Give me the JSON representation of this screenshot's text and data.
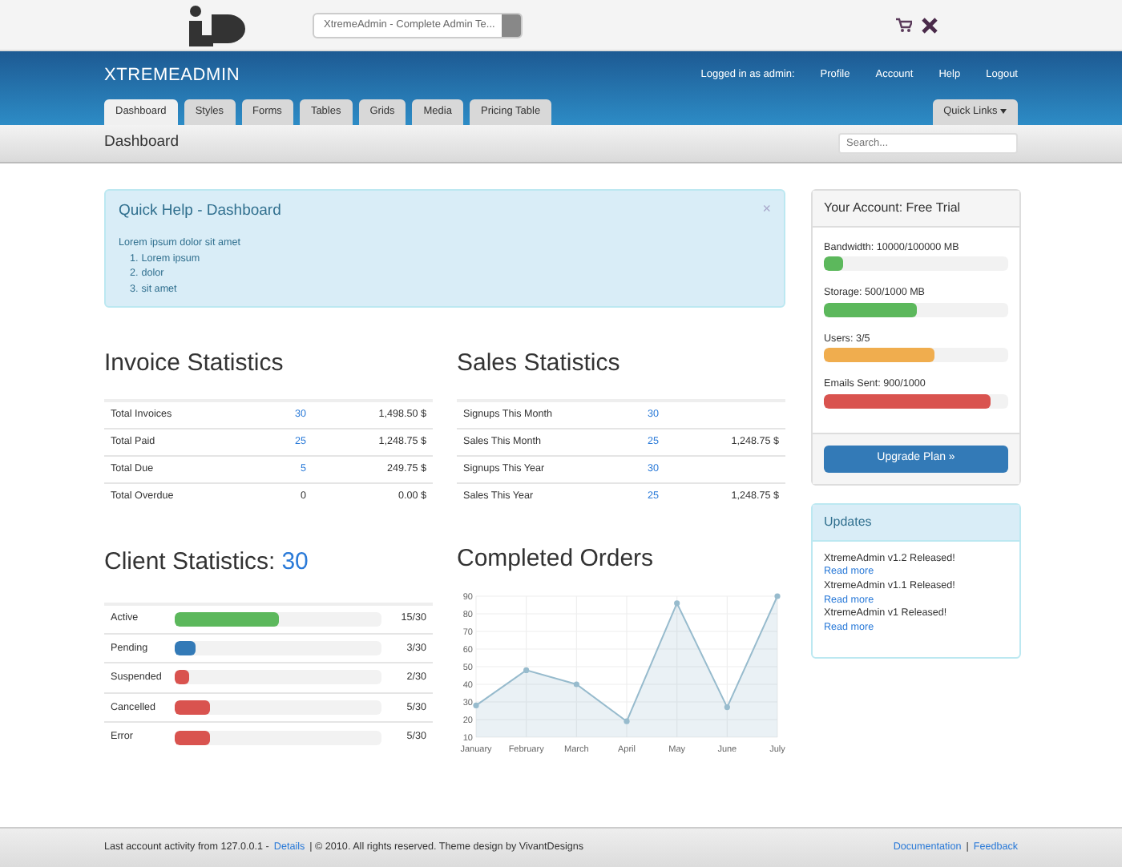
{
  "topbar": {
    "site_select": "XtremeAdmin - Complete Admin Te..."
  },
  "header": {
    "brand": "XTREMEADMIN",
    "user_label": "Logged in as admin:",
    "user_links": [
      "Profile",
      "Account",
      "Help",
      "Logout"
    ],
    "tabs": [
      {
        "label": "Dashboard",
        "selected": true
      },
      {
        "label": "Styles",
        "selected": false
      },
      {
        "label": "Forms",
        "selected": false
      },
      {
        "label": "Tables",
        "selected": false
      },
      {
        "label": "Grids",
        "selected": false
      },
      {
        "label": "Media",
        "selected": false
      },
      {
        "label": "Pricing Table",
        "selected": false
      }
    ],
    "quick_links": "Quick Links"
  },
  "subheader": {
    "title": "Dashboard",
    "search_placeholder": "Search..."
  },
  "quick_help": {
    "title": "Quick Help - Dashboard",
    "close": "×",
    "text": "Lorem ipsum dolor sit amet",
    "items": [
      {
        "marker": "1.",
        "text": "Lorem ipsum"
      },
      {
        "marker": "2.",
        "text": "dolor"
      },
      {
        "marker": "3.",
        "text": "sit amet"
      }
    ]
  },
  "invoice_statistics": {
    "title": "Invoice Statistics",
    "rows": [
      {
        "label": "Total Invoices",
        "count": "30",
        "link": true,
        "amount": "1,498.50 $"
      },
      {
        "label": "Total Paid",
        "count": "25",
        "link": true,
        "amount": "1,248.75 $"
      },
      {
        "label": "Total Due",
        "count": "5",
        "link": true,
        "amount": "249.75 $"
      },
      {
        "label": "Total Overdue",
        "count": "0",
        "link": false,
        "amount": "0.00 $"
      }
    ]
  },
  "sales_statistics": {
    "title": "Sales Statistics",
    "rows": [
      {
        "label": "Signups This Month",
        "count": "30",
        "link": true
      },
      {
        "label": "Sales This Month",
        "count": "25",
        "link": true,
        "amount": "1,248.75 $"
      },
      {
        "label": "Signups This Year",
        "count": "30",
        "link": true
      },
      {
        "label": "Sales This Year",
        "count": "25",
        "link": true,
        "amount": "1,248.75 $"
      }
    ]
  },
  "client_statistics": {
    "title": "Client Statistics:",
    "total": "30",
    "rows": [
      {
        "label": "Active",
        "level": 0.5,
        "color": "#5cb85c",
        "reading": "15/30"
      },
      {
        "label": "Pending",
        "level": 0.1,
        "color": "#337ab7",
        "reading": "3/30"
      },
      {
        "label": "Suspended",
        "level": 0.067,
        "color": "#d9534f",
        "reading": "2/30"
      },
      {
        "label": "Cancelled",
        "level": 0.167,
        "color": "#d9534f",
        "reading": "5/30"
      },
      {
        "label": "Error",
        "level": 0.167,
        "color": "#d9534f",
        "reading": "5/30"
      }
    ]
  },
  "completed_orders": {
    "title": "Completed Orders",
    "chart_data": {
      "type": "area",
      "categories": [
        "January",
        "February",
        "March",
        "April",
        "May",
        "June",
        "July"
      ],
      "series": [
        {
          "color": "#97bbcd",
          "values": [
            28,
            48,
            40,
            19,
            86,
            27,
            90
          ]
        }
      ],
      "ylim": [
        10,
        90
      ],
      "yticks": [
        10,
        20,
        30,
        40,
        50,
        60,
        70,
        80,
        90
      ],
      "grid": true
    }
  },
  "account": {
    "title": "Your Account: Free Trial",
    "meters": [
      {
        "label": "Bandwidth: 10000/100000 MB",
        "level": 0.1,
        "color": "#5cb85c"
      },
      {
        "label": "Storage: 500/1000 MB",
        "level": 0.5,
        "color": "#5cb85c"
      },
      {
        "label": "Users: 3/5",
        "level": 0.6,
        "color": "#f0ad4e"
      },
      {
        "label": "Emails Sent: 900/1000",
        "level": 0.9,
        "color": "#d9534f"
      }
    ],
    "button": "Upgrade Plan »"
  },
  "updates": {
    "title": "Updates",
    "items": [
      {
        "text": "XtremeAdmin v1.2 Released!",
        "link": "Read more"
      },
      {
        "text": "XtremeAdmin v1.1 Released!",
        "link": "Read more"
      },
      {
        "text": "XtremeAdmin v1 Released!",
        "link": "Read more"
      }
    ]
  },
  "footer": {
    "text_before": "Last account activity from 127.0.0.1 -",
    "details_link": "Details",
    "text_after": "| © 2010. All rights reserved. Theme design by VivantDesigns",
    "links": [
      "Documentation",
      "Feedback"
    ],
    "separator": "|"
  }
}
